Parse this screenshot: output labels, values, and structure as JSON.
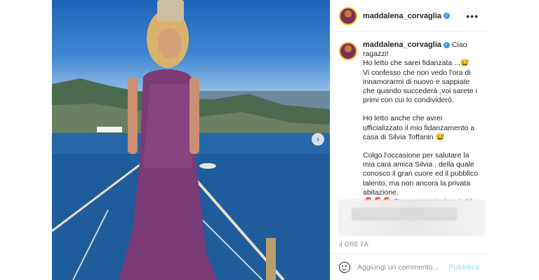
{
  "post": {
    "username": "maddalena_corvaglia",
    "verified_mark": "✓",
    "more_label": "•••",
    "caption_greeting": "Ciao ragazzi!",
    "caption_paragraphs": [
      "Ho letto che sarei fidanzata ...😅\nVi confesso che non vedo l'ora di innamorarmi di nuovo e sappiate che quando succederà ,voi sarete i primi con cui lo condividerò.",
      "Ho letto anche che avrei ufficializzato il mio fidanzamento a casa di Silvia Toffanin 😅",
      "Colgo l'occasione per salutare la mia cara amica Silvia , della quale conosco il gran cuore ed il pubblico talento, ma non ancora la privata abitazione.\n💋💋💋. Buon pomeriggio a tutti! 😜😊"
    ],
    "time_ago": "4 ORE FA",
    "next_arrow": "›"
  },
  "composer": {
    "placeholder": "Aggiungi un commento...",
    "publish_label": "Pubblica",
    "emoji_icon": "smiley-icon"
  },
  "colors": {
    "verified": "#3897f0",
    "publish_disabled": "#b2dffc",
    "avatar_ring": "#f7c21d"
  }
}
